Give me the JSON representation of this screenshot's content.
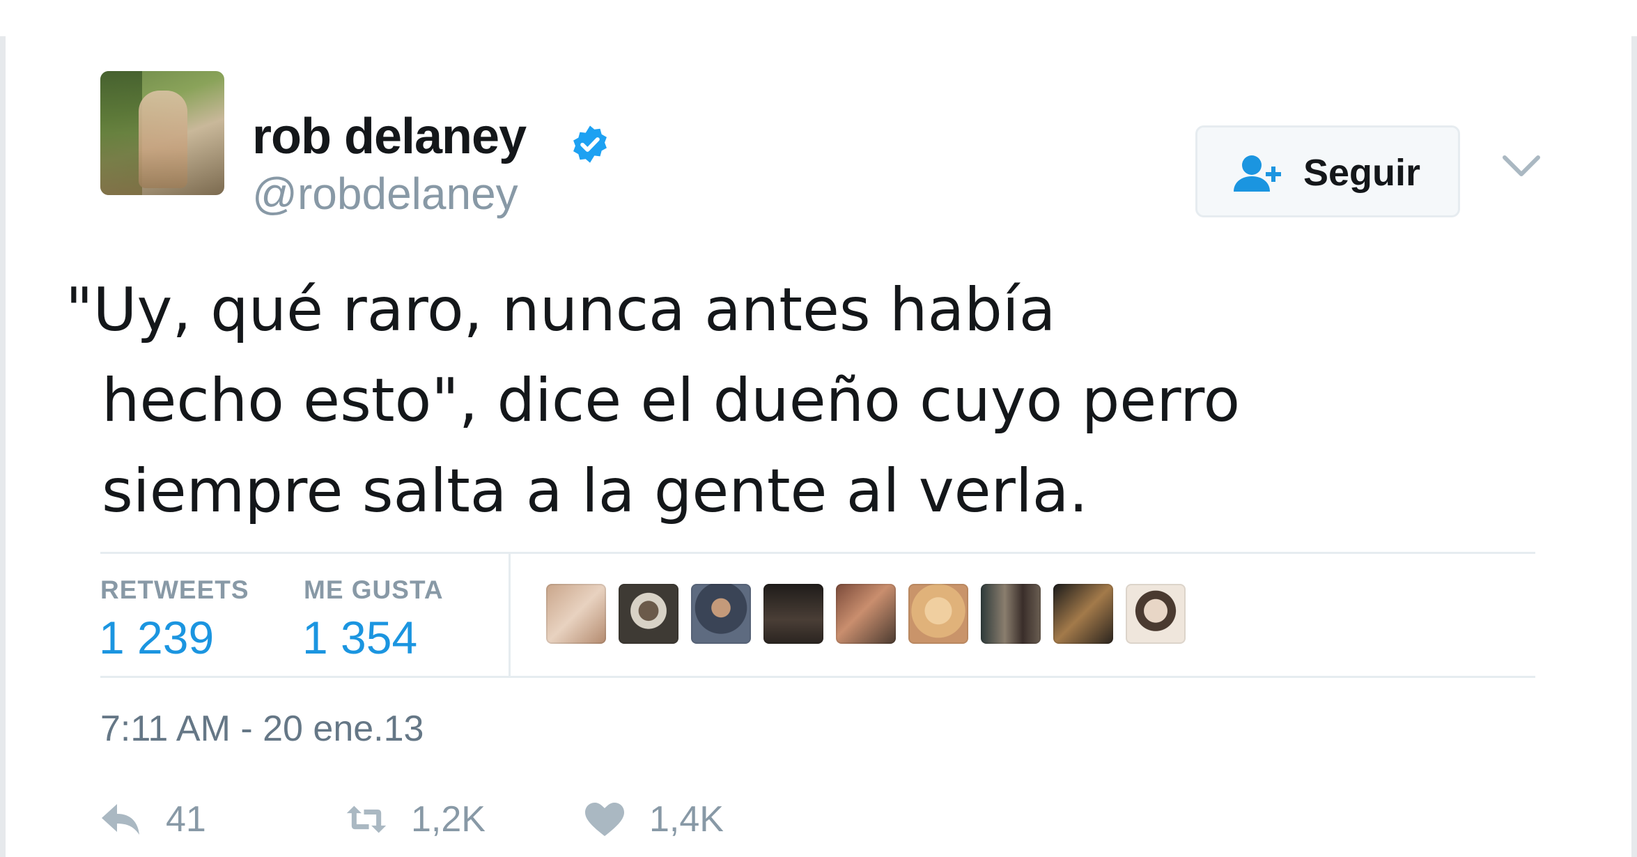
{
  "author": {
    "name": "rob delaney",
    "handle": "@robdelaney",
    "verified": true
  },
  "follow_button": {
    "label": "Seguir",
    "icon": "add-user-icon"
  },
  "menu": {
    "icon": "chevron-down-icon"
  },
  "tweet": {
    "text_lines": [
      "\"Uy, qué raro, nunca antes había",
      "hecho esto\", dice el dueño cuyo perro",
      "siempre salta a la gente al verla."
    ]
  },
  "stats": {
    "retweets_label": "RETWEETS",
    "retweets_value": "1 239",
    "likes_label": "ME GUSTA",
    "likes_value": "1 354",
    "liker_avatar_count": 9
  },
  "timestamp": "7:11 AM - 20 ene.13",
  "actions": {
    "reply": {
      "icon": "reply-icon",
      "count": "41"
    },
    "retweet": {
      "icon": "retweet-icon",
      "count": "1,2K"
    },
    "like": {
      "icon": "heart-icon",
      "count": "1,4K"
    }
  },
  "colors": {
    "text": "#14171a",
    "muted": "#8899a6",
    "accent": "#1b95e0",
    "verified": "#1da1f2",
    "border": "#e6ecf0"
  }
}
